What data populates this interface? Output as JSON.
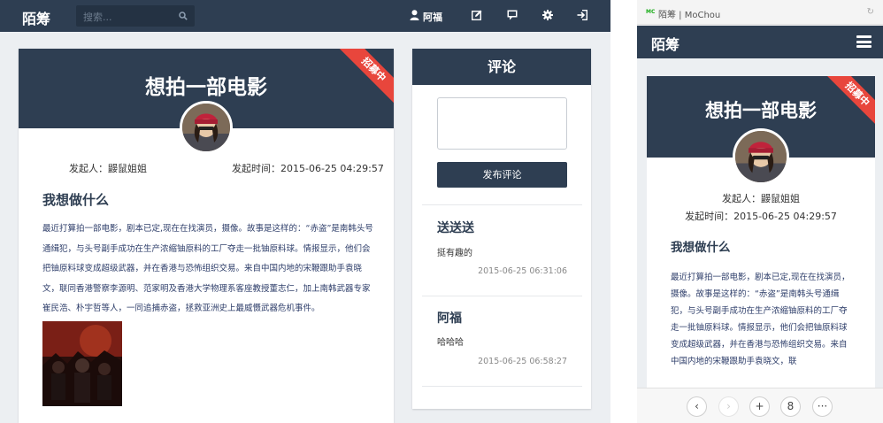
{
  "desktop": {
    "navbar": {
      "brand": "陌筹",
      "search_placeholder": "搜索...",
      "user_name": "阿福"
    },
    "project": {
      "title": "想拍一部电影",
      "ribbon": "招募中",
      "initiator": "发起人：鼹鼠姐姐",
      "time": "发起时间：2015-06-25 04:29:57",
      "section_title": "我想做什么",
      "description": "最近打算拍一部电影，剧本已定,现在在找演员，摄像。故事是这样的：“赤盗”是南韩头号通缉犯，与头号副手成功在生产浓缩铀原料的工厂夺走一批铀原料球。情报显示，他们会把铀原料球变成超级武器，并在香港与恐怖组织交易。来自中国内地的宋鞭跟助手袁晓文，联同香港警察李源明、范家明及香港大学物理系客座教授董志仁，加上南韩武器专家崔民浩、朴宇哲等人，一同追捕赤盗，拯救亚洲史上最威慑武器危机事件。"
    },
    "comments": {
      "header": "评论",
      "submit_label": "发布评论",
      "items": [
        {
          "author": "送送送",
          "text": "挺有趣的",
          "time": "2015-06-25 06:31:06"
        },
        {
          "author": "阿福",
          "text": "哈哈哈",
          "time": "2015-06-25 06:58:27"
        }
      ]
    }
  },
  "mobile": {
    "page_title": "陌筹 | MoChou",
    "favicon_text": "MC",
    "brand": "陌筹",
    "project": {
      "title": "想拍一部电影",
      "ribbon": "招募中",
      "initiator": "发起人：鼹鼠姐姐",
      "time": "发起时间：2015-06-25 04:29:57",
      "section_title": "我想做什么",
      "description": "最近打算拍一部电影，剧本已定,现在在找演员，摄像。故事是这样的：“赤盗”是南韩头号通缉犯，与头号副手成功在生产浓缩铀原料的工厂夺走一批铀原料球。情报显示，他们会把铀原料球变成超级武器，并在香港与恐怖组织交易。来自中国内地的宋鞭跟助手袁晓文，联"
    },
    "toolbar": {
      "back": "‹",
      "forward": "›",
      "new_tab": "+",
      "tab_count": "8",
      "more": "···"
    }
  },
  "colors": {
    "navy": "#2e3e52",
    "ribbon_red": "#e8463c",
    "page_bg": "#eceff2",
    "text_blue": "#2e3e6a"
  }
}
